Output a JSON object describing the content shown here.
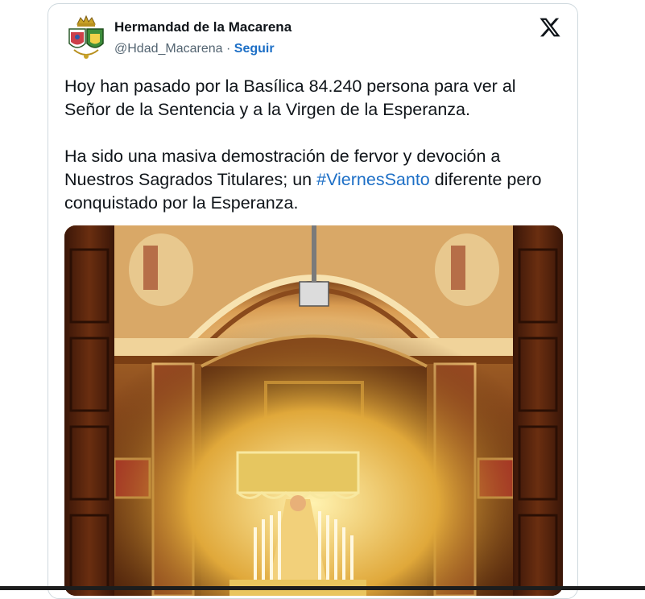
{
  "tweet": {
    "author_name": "Hermandad de la Macarena",
    "author_handle": "@Hdad_Macarena",
    "separator": " · ",
    "follow_label": "Seguir",
    "paragraph1": "Hoy han pasado por la Basílica 84.240 persona para ver al Señor de la Sentencia y a la Virgen de la Esperanza.",
    "paragraph2_before": "Ha sido una masiva demostración de fervor y devoción a Nuestros Sagrados Titulares; un ",
    "hashtag": "#ViernesSanto",
    "paragraph2_after": " diferente pero conquistado por la Esperanza."
  },
  "icons": {
    "brand": "x-logo-icon",
    "avatar": "hermandad-crest-icon"
  },
  "colors": {
    "link": "#1d6fc6",
    "text": "#0f1419",
    "secondary": "#536471",
    "border": "#cfd9de"
  }
}
